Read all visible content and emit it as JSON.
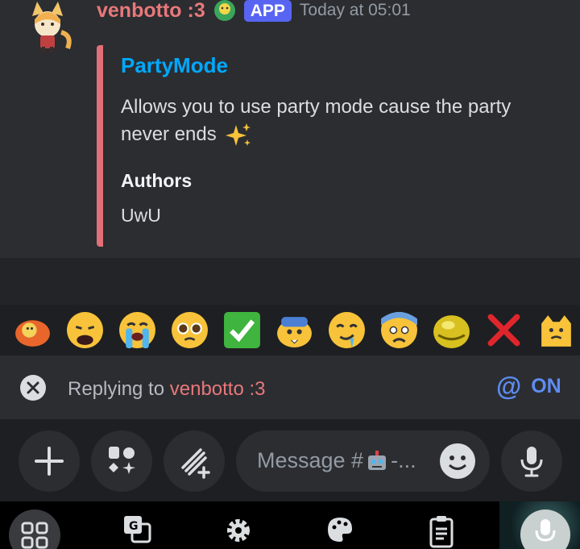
{
  "message": {
    "author": "venbotto :3",
    "app_tag": "APP",
    "timestamp": "Today at 05:01",
    "embed": {
      "title": "PartyMode",
      "description": "Allows you to use party mode cause the party never ends",
      "sparkle_icon": "sparkles-icon",
      "field_name": "Authors",
      "field_value": "UwU",
      "accent_color": "#e17078"
    }
  },
  "emoji_bar": {
    "emojis": [
      "custom-orange-emoji",
      "weary-face",
      "loudly-crying-face",
      "pleading-face",
      "check-mark-button",
      "custom-blob-emoji",
      "drooling-face",
      "anxious-face",
      "custom-yellow-blob",
      "cross-mark",
      "custom-cat-emoji"
    ]
  },
  "reply": {
    "prefix": "Replying to",
    "user": "venbotto :3",
    "mention_symbol": "@",
    "mention_state": "ON"
  },
  "composer": {
    "placeholder_prefix": "Message #",
    "placeholder_suffix": "-..."
  },
  "colors": {
    "accent_blue": "#5865f2",
    "username": "#e8787a",
    "link": "#00a8fc"
  }
}
